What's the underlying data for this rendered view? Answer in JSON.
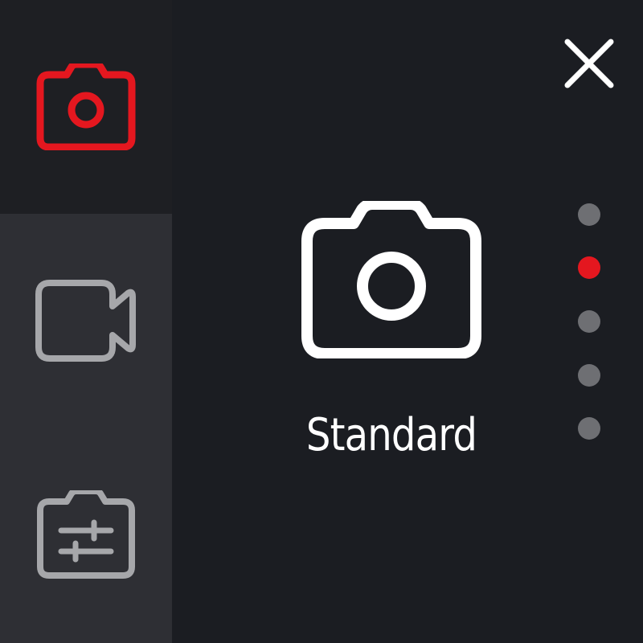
{
  "sidebar": {
    "items": [
      {
        "icon": "camera-icon",
        "active": true
      },
      {
        "icon": "video-camera-icon",
        "active": false
      },
      {
        "icon": "camera-settings-icon",
        "active": false
      }
    ]
  },
  "header": {
    "close_icon": "close-icon"
  },
  "main": {
    "mode_icon": "camera-icon",
    "mode_label": "Standard"
  },
  "pager": {
    "count": 5,
    "active_index": 1
  },
  "colors": {
    "accent": "#e4171f",
    "background": "#1b1d22",
    "sidebar": "#2e2f34",
    "sidebar_active": "#1e1f23",
    "inactive_icon": "#a6a7aa",
    "inactive_dot": "#6e6f73",
    "text": "#ffffff"
  }
}
